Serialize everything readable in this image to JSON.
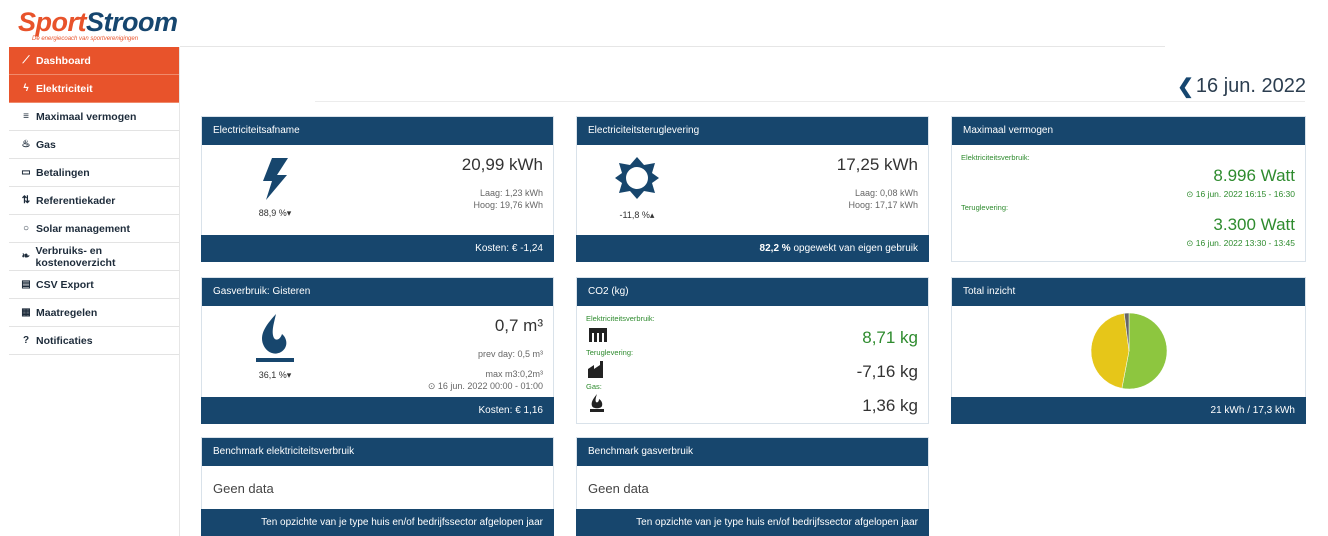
{
  "logo": {
    "part1": "Sport",
    "part2": "Stroom",
    "tagline": "De energiecoach van sportverenigingen"
  },
  "sidebar": {
    "items": [
      {
        "label": "Dashboard",
        "icon": "chart-line-icon",
        "glyph": "⟋"
      },
      {
        "label": "Elektriciteit",
        "icon": "bolt-icon",
        "glyph": "ϟ"
      },
      {
        "label": "Maximaal vermogen",
        "icon": "list-icon",
        "glyph": "≡"
      },
      {
        "label": "Gas",
        "icon": "fire-icon",
        "glyph": "♨"
      },
      {
        "label": "Betalingen",
        "icon": "money-icon",
        "glyph": "▭"
      },
      {
        "label": "Referentiekader",
        "icon": "sort-icon",
        "glyph": "⇅"
      },
      {
        "label": "Solar management",
        "icon": "circle-icon",
        "glyph": "○"
      },
      {
        "label": "Verbruiks- en kostenoverzicht",
        "icon": "leaf-icon",
        "glyph": "❧"
      },
      {
        "label": "CSV Export",
        "icon": "file-icon",
        "glyph": "▤"
      },
      {
        "label": "Maatregelen",
        "icon": "calendar-icon",
        "glyph": "▦"
      },
      {
        "label": "Notificaties",
        "icon": "question-icon",
        "glyph": "?"
      }
    ]
  },
  "date": {
    "back": "❮",
    "label": "16 jun. 2022"
  },
  "cards": {
    "afname": {
      "title": "Electriciteitsafname",
      "value": "20,99 kWh",
      "laag": "Laag: 1,23 kWh",
      "hoog": "Hoog: 19,76 kWh",
      "pct": "88,9 %",
      "footer_prefix": "Kosten: ",
      "footer_value": "€ -1,24"
    },
    "teruglevering": {
      "title": "Electriciteitsteruglevering",
      "value": "17,25 kWh",
      "laag": "Laag: 0,08 kWh",
      "hoog": "Hoog: 17,17 kWh",
      "pct": "-11,8 %",
      "footer_bold": "82,2 %",
      "footer_rest": " opgewekt van eigen gebruik"
    },
    "vermogen": {
      "title": "Maximaal vermogen",
      "label1": "Elektriciteitsverbruik:",
      "value1": "8.996 Watt",
      "time1": "16 jun. 2022 16:15 - 16:30",
      "label2": "Teruglevering:",
      "value2": "3.300 Watt",
      "time2": "16 jun. 2022 13:30 - 13:45"
    },
    "gas": {
      "title": "Gasverbruik: Gisteren",
      "value": "0,7 m³",
      "prev": "prev day: 0,5 m³",
      "max": "max m3:0,2m³",
      "time": "16 jun. 2022 00:00 - 01:00",
      "pct": "36,1 %",
      "footer_prefix": "Kosten: ",
      "footer_value": "€ 1,16"
    },
    "co2": {
      "title": "CO2 (kg)",
      "label1": "Elektriciteitsverbruik:",
      "value1": "8,71 kg",
      "label2": "Teruglevering:",
      "value2": "-7,16 kg",
      "label3": "Gas:",
      "value3": "1,36 kg"
    },
    "total": {
      "title": "Total inzicht",
      "footer": "21 kWh / 17,3 kWh",
      "pie": [
        {
          "value": 53,
          "color": "#8dc63f"
        },
        {
          "value": 45,
          "color": "#e6c619"
        },
        {
          "value": 2,
          "color": "#666666"
        }
      ]
    },
    "bench_elec": {
      "title": "Benchmark elektriciteitsverbruik",
      "body": "Geen data",
      "footer": "Ten opzichte van je type huis en/of bedrijfssector afgelopen jaar"
    },
    "bench_gas": {
      "title": "Benchmark gasverbruik",
      "body": "Geen data",
      "footer": "Ten opzichte van je type huis en/of bedrijfssector afgelopen jaar"
    }
  },
  "colors": {
    "navy": "#17466d",
    "orange": "#e8532b",
    "green": "#2e8b2e"
  }
}
